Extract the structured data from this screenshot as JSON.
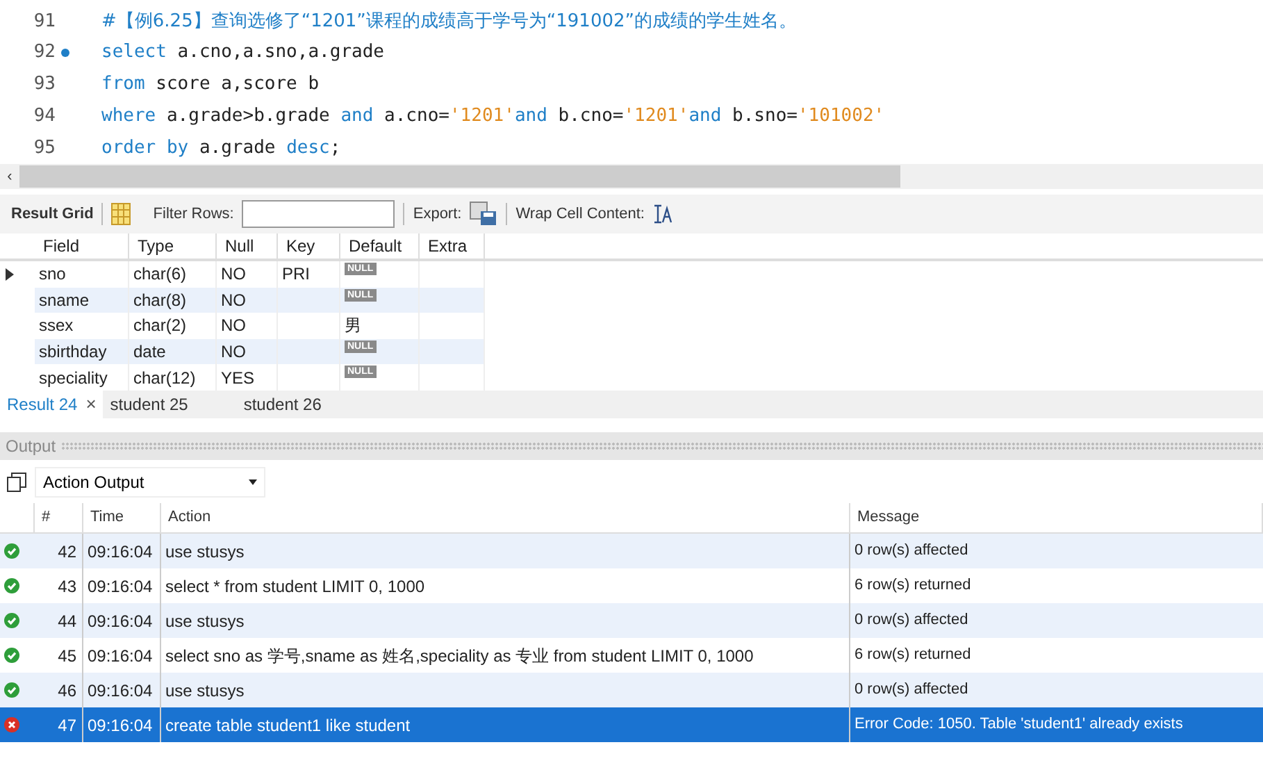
{
  "editor": {
    "lines": [
      {
        "number": "91",
        "marker": false,
        "tokens": [
          {
            "kind": "comment",
            "text": "#【例6.25】查询选修了“1201”课程的成绩高于学号为“191002”的成绩的学生姓名。"
          }
        ]
      },
      {
        "number": "92",
        "marker": true,
        "tokens": [
          {
            "kind": "keyword",
            "text": "select"
          },
          {
            "kind": "plain",
            "text": " a.cno,a.sno,a.grade"
          }
        ]
      },
      {
        "number": "93",
        "marker": false,
        "tokens": [
          {
            "kind": "keyword",
            "text": "from"
          },
          {
            "kind": "plain",
            "text": " score a,score b"
          }
        ]
      },
      {
        "number": "94",
        "marker": false,
        "tokens": [
          {
            "kind": "keyword",
            "text": "where"
          },
          {
            "kind": "plain",
            "text": " a.grade>b.grade "
          },
          {
            "kind": "keyword",
            "text": "and"
          },
          {
            "kind": "plain",
            "text": " a.cno="
          },
          {
            "kind": "string",
            "text": "'1201'"
          },
          {
            "kind": "keyword",
            "text": "and"
          },
          {
            "kind": "plain",
            "text": " b.cno="
          },
          {
            "kind": "string",
            "text": "'1201'"
          },
          {
            "kind": "keyword",
            "text": "and"
          },
          {
            "kind": "plain",
            "text": " b.sno="
          },
          {
            "kind": "string",
            "text": "'101002'"
          }
        ]
      },
      {
        "number": "95",
        "marker": false,
        "tokens": [
          {
            "kind": "keyword",
            "text": "order by"
          },
          {
            "kind": "plain",
            "text": " a.grade "
          },
          {
            "kind": "keyword",
            "text": "desc"
          },
          {
            "kind": "plain",
            "text": ";"
          }
        ]
      }
    ],
    "scroll_arrow": "‹"
  },
  "result_toolbar": {
    "title": "Result Grid",
    "filter_label": "Filter Rows:",
    "export_label": "Export:",
    "wrap_label": "Wrap Cell Content:"
  },
  "result_grid": {
    "columns": [
      "Field",
      "Type",
      "Null",
      "Key",
      "Default",
      "Extra"
    ],
    "rows": [
      {
        "current": true,
        "cells": [
          {
            "kind": "text",
            "text": "sno"
          },
          {
            "kind": "text",
            "text": "char(6)"
          },
          {
            "kind": "text",
            "text": "NO"
          },
          {
            "kind": "text",
            "text": "PRI"
          },
          {
            "kind": "null",
            "text": "NULL"
          },
          {
            "kind": "text",
            "text": ""
          }
        ]
      },
      {
        "current": false,
        "cells": [
          {
            "kind": "text",
            "text": "sname"
          },
          {
            "kind": "text",
            "text": "char(8)"
          },
          {
            "kind": "text",
            "text": "NO"
          },
          {
            "kind": "text",
            "text": ""
          },
          {
            "kind": "null",
            "text": "NULL"
          },
          {
            "kind": "text",
            "text": ""
          }
        ]
      },
      {
        "current": false,
        "cells": [
          {
            "kind": "text",
            "text": "ssex"
          },
          {
            "kind": "text",
            "text": "char(2)"
          },
          {
            "kind": "text",
            "text": "NO"
          },
          {
            "kind": "text",
            "text": ""
          },
          {
            "kind": "text",
            "text": "男"
          },
          {
            "kind": "text",
            "text": ""
          }
        ]
      },
      {
        "current": false,
        "cells": [
          {
            "kind": "text",
            "text": "sbirthday"
          },
          {
            "kind": "text",
            "text": "date"
          },
          {
            "kind": "text",
            "text": "NO"
          },
          {
            "kind": "text",
            "text": ""
          },
          {
            "kind": "null",
            "text": "NULL"
          },
          {
            "kind": "text",
            "text": ""
          }
        ]
      },
      {
        "current": false,
        "cells": [
          {
            "kind": "text",
            "text": "speciality"
          },
          {
            "kind": "text",
            "text": "char(12)"
          },
          {
            "kind": "text",
            "text": "YES"
          },
          {
            "kind": "text",
            "text": ""
          },
          {
            "kind": "null",
            "text": "NULL"
          },
          {
            "kind": "text",
            "text": ""
          }
        ]
      }
    ]
  },
  "result_tabs": [
    {
      "label": "Result 24",
      "selected": true,
      "close": "×"
    },
    {
      "label": "student 25",
      "selected": false
    },
    {
      "label": "student 26",
      "selected": false
    }
  ],
  "output": {
    "title": "Output",
    "selector": "Action Output",
    "columns": [
      "#",
      "Time",
      "Action",
      "Message"
    ],
    "rows": [
      {
        "kind": "ok",
        "selected": false,
        "number": "42",
        "time": "09:16:04",
        "action": "use stusys",
        "message": "0 row(s) affected"
      },
      {
        "kind": "ok",
        "selected": false,
        "number": "43",
        "time": "09:16:04",
        "action": "select * from student LIMIT 0, 1000",
        "message": "6 row(s) returned"
      },
      {
        "kind": "ok",
        "selected": false,
        "number": "44",
        "time": "09:16:04",
        "action": "use stusys",
        "message": "0 row(s) affected"
      },
      {
        "kind": "ok",
        "selected": false,
        "number": "45",
        "time": "09:16:04",
        "action": "select sno as 学号,sname as 姓名,speciality as 专业 from student LIMIT 0, 1000",
        "message": "6 row(s) returned"
      },
      {
        "kind": "ok",
        "selected": false,
        "number": "46",
        "time": "09:16:04",
        "action": "use stusys",
        "message": "0 row(s) affected"
      },
      {
        "kind": "error",
        "selected": true,
        "number": "47",
        "time": "09:16:04",
        "action": "create table student1 like student",
        "message": "Error Code: 1050. Table 'student1' already exists"
      }
    ]
  }
}
